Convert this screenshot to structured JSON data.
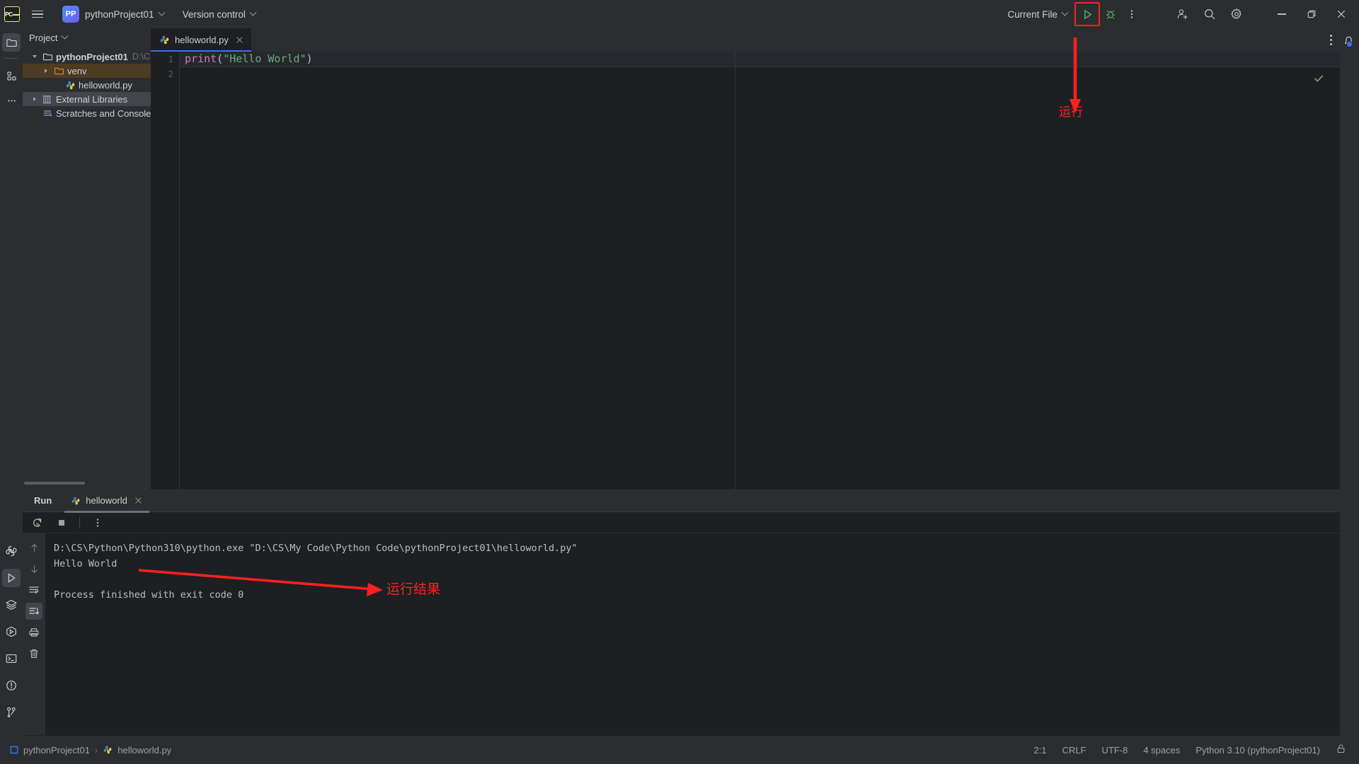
{
  "titlebar": {
    "logo_text": "PC",
    "project_badge": "PP",
    "project_name": "pythonProject01",
    "version_control": "Version control",
    "run_config": "Current File",
    "icons": {
      "hamburger": "hamburger-icon",
      "run": "run-icon",
      "debug": "debug-icon",
      "more": "more-options-icon",
      "add_user": "add-user-icon",
      "search": "search-icon",
      "settings": "settings-gear-icon",
      "minimize": "minimize-icon",
      "maximize": "maximize-icon",
      "close": "close-icon"
    }
  },
  "toolstrip": {
    "top": [
      {
        "name": "project",
        "icon": "folder-icon",
        "active": true
      },
      {
        "name": "structure",
        "icon": "structure-icon",
        "active": false
      },
      {
        "name": "more-tool-windows",
        "icon": "ellipsis-icon",
        "active": false
      }
    ],
    "bottom": [
      {
        "name": "python-console",
        "icon": "python-console-icon",
        "active": false
      },
      {
        "name": "run",
        "icon": "run-icon",
        "active": true
      },
      {
        "name": "services",
        "icon": "layers-icon",
        "active": false
      },
      {
        "name": "debug",
        "icon": "debug-hex-icon",
        "active": false
      },
      {
        "name": "terminal",
        "icon": "terminal-icon",
        "active": false
      },
      {
        "name": "problems",
        "icon": "problems-icon",
        "active": false
      },
      {
        "name": "version-control",
        "icon": "git-branch-icon",
        "active": false
      }
    ]
  },
  "project_panel": {
    "title": "Project",
    "tree": [
      {
        "label": "pythonProject01",
        "path": "D:\\CS\\My",
        "icon": "folder-icon",
        "depth": 0,
        "expanded": true,
        "bold": true,
        "state": "none"
      },
      {
        "label": "venv",
        "path": "",
        "icon": "folder-orange-icon",
        "depth": 1,
        "expanded": false,
        "bold": false,
        "state": "venv"
      },
      {
        "label": "helloworld.py",
        "path": "",
        "icon": "python-file-icon",
        "depth": 2,
        "expanded": null,
        "bold": false,
        "state": "none"
      },
      {
        "label": "External Libraries",
        "path": "",
        "icon": "library-icon",
        "depth": 0,
        "expanded": false,
        "bold": false,
        "state": "lib"
      },
      {
        "label": "Scratches and Consoles",
        "path": "",
        "icon": "scratches-icon",
        "depth": 0,
        "expanded": null,
        "bold": false,
        "state": "none"
      }
    ]
  },
  "editor": {
    "tab": {
      "label": "helloworld.py",
      "icon": "python-file-icon"
    },
    "lines": [
      {
        "number": "1",
        "tokens": [
          {
            "text": "print",
            "cls": "k-fn"
          },
          {
            "text": "(",
            "cls": "k-pn"
          },
          {
            "text": "\"Hello World\"",
            "cls": "k-st"
          },
          {
            "text": ")",
            "cls": "k-pn"
          }
        ]
      },
      {
        "number": "2",
        "tokens": []
      }
    ],
    "inspection_status": "ok-checkmark"
  },
  "run_panel": {
    "title": "Run",
    "tab_label": "helloworld",
    "tab_icon": "python-file-icon",
    "toolbar": [
      {
        "name": "rerun",
        "icon": "rerun-icon"
      },
      {
        "name": "stop",
        "icon": "stop-icon"
      },
      {
        "name": "more",
        "icon": "kebab-icon"
      }
    ],
    "side_buttons": [
      {
        "name": "up",
        "icon": "arrow-up-icon",
        "active": false
      },
      {
        "name": "down",
        "icon": "arrow-down-icon",
        "active": false
      },
      {
        "name": "soft-wrap",
        "icon": "soft-wrap-icon",
        "active": false
      },
      {
        "name": "scroll-to-end",
        "icon": "scroll-to-end-icon",
        "active": true
      },
      {
        "name": "print",
        "icon": "printer-icon",
        "active": false
      },
      {
        "name": "clear-all",
        "icon": "trash-icon",
        "active": false
      }
    ],
    "console_lines": [
      "D:\\CS\\Python\\Python310\\python.exe \"D:\\CS\\My Code\\Python Code\\pythonProject01\\helloworld.py\"",
      "Hello World",
      "",
      "Process finished with exit code 0"
    ]
  },
  "status_bar": {
    "breadcrumb_project": "pythonProject01",
    "breadcrumb_sep": "›",
    "breadcrumb_file": "helloworld.py",
    "caret": "2:1",
    "line_sep": "CRLF",
    "encoding": "UTF-8",
    "indent": "4 spaces",
    "interpreter": "Python 3.10 (pythonProject01)",
    "lock_icon": "lock-icon"
  },
  "right_strip": {
    "notifications_icon": "bell-icon",
    "has_badge": true
  },
  "annotations": [
    {
      "name": "run-button-annotation",
      "label": "运行",
      "color": "#ff2020"
    },
    {
      "name": "run-result-annotation",
      "label": "运行结果",
      "color": "#ff2020"
    }
  ],
  "colors": {
    "accent": "#3574f0",
    "annotation": "#ff2020",
    "bg_editor": "#1e1f22",
    "bg_panel": "#2b2d30",
    "string": "#6aab73",
    "function": "#c77dbb"
  }
}
